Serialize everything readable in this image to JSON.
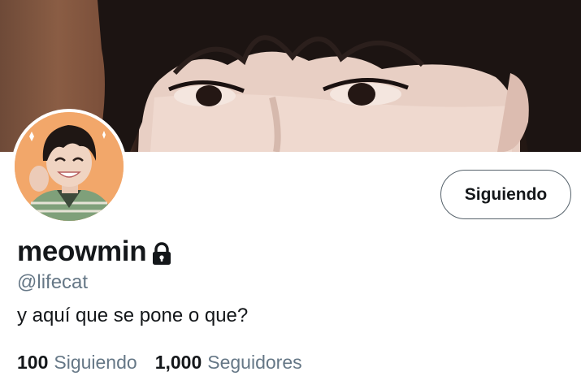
{
  "profile": {
    "display_name": "meowmin",
    "handle": "@lifecat",
    "bio": "y aquí que se pone o que?",
    "locked_icon": "lock-icon"
  },
  "actions": {
    "follow_label": "Siguiendo"
  },
  "stats": {
    "following_count": "100",
    "following_label": "Siguiendo",
    "followers_count": "1,000",
    "followers_label": "Seguidores"
  },
  "colors": {
    "primary_text": "#14171a",
    "secondary_text": "#657786",
    "button_border": "#56626b",
    "avatar_background": "#f2a76a"
  }
}
